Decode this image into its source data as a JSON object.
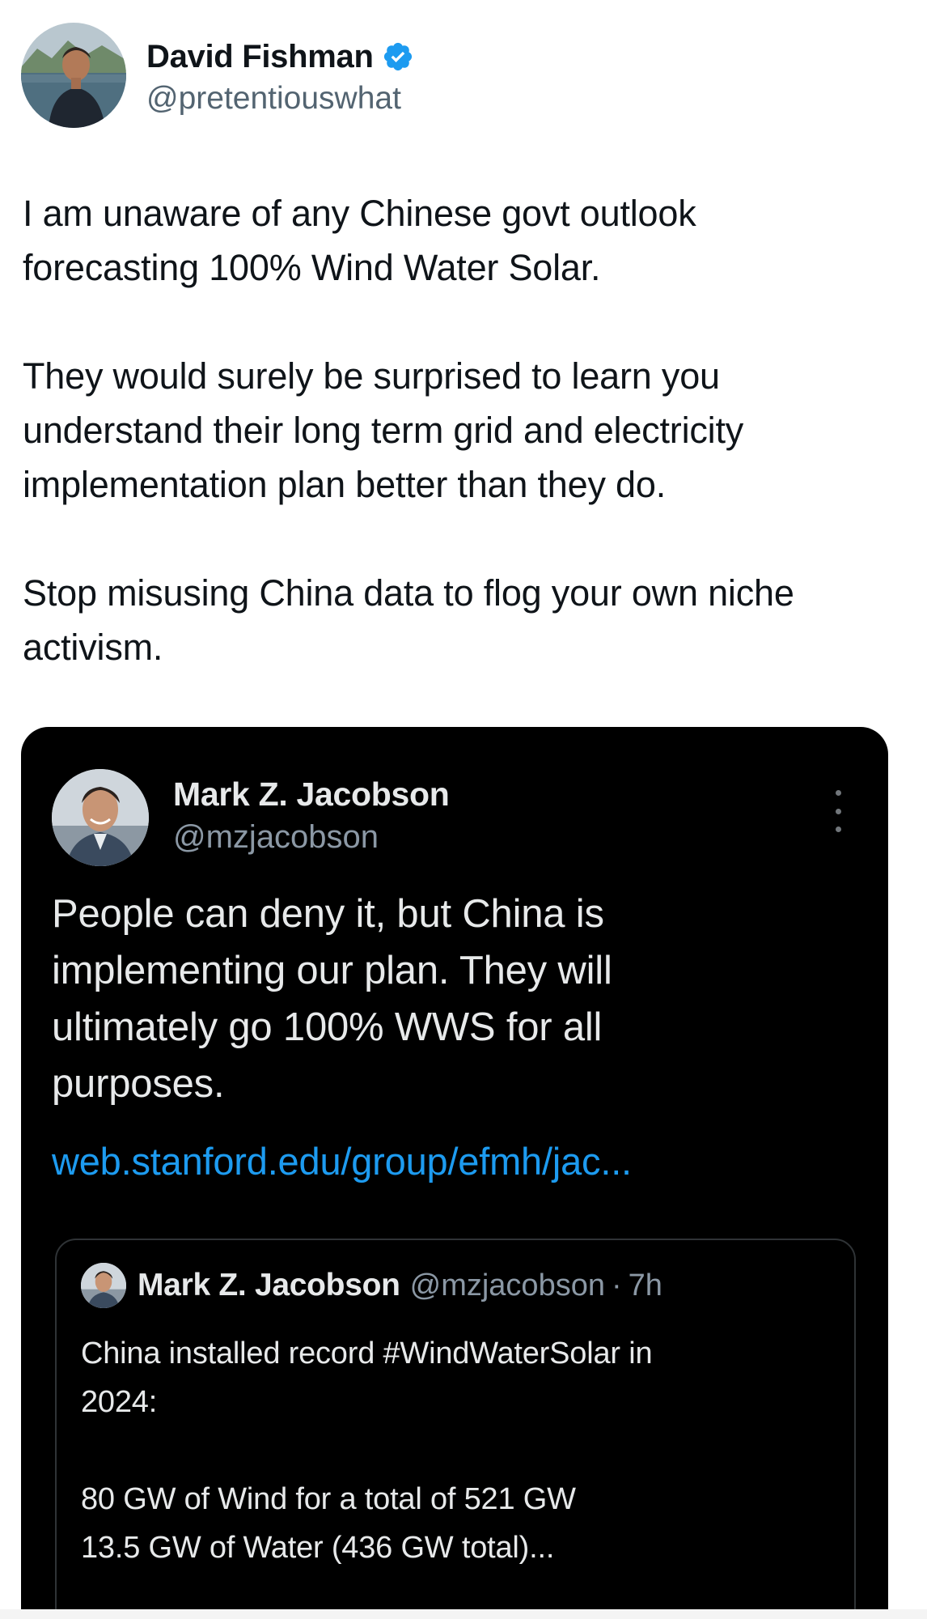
{
  "tweet": {
    "author": {
      "name": "David Fishman",
      "handle": "@pretentiouswhat",
      "verified": true,
      "avatar_icon": "avatar-photo-lake"
    },
    "paragraphs": [
      "I am unaware of any Chinese govt outlook\nforecasting 100% Wind Water Solar.",
      "They would surely be surprised to learn you\nunderstand their long term grid and electricity\nimplementation plan better than they do.",
      "Stop misusing China data to flog your own niche\nactivism."
    ]
  },
  "quoted_screenshot": {
    "author": {
      "name": "Mark Z. Jacobson",
      "handle": "@mzjacobson",
      "avatar_icon": "avatar-photo-portrait"
    },
    "more_icon": "vertical-ellipsis-icon",
    "text": "People can deny it, but China is\nimplementing our plan. They will\nultimately go 100% WWS for all\npurposes.",
    "link": "web.stanford.edu/group/efmh/jac...",
    "nested_quote": {
      "author_name": "Mark Z. Jacobson",
      "author_handle": "@mzjacobson",
      "separator": "·",
      "time": "7h",
      "paragraphs": [
        "China installed record #WindWaterSolar in\n2024:",
        "80 GW of Wind for a total of 521 GW\n13.5 GW of Water (436 GW total)..."
      ]
    }
  },
  "colors": {
    "verified_badge": "#1d9bf0",
    "link": "#1d9bf0",
    "dark_card_bg": "#000000",
    "dark_text": "#e7e9ea",
    "dark_secondary": "#8b98a5"
  }
}
